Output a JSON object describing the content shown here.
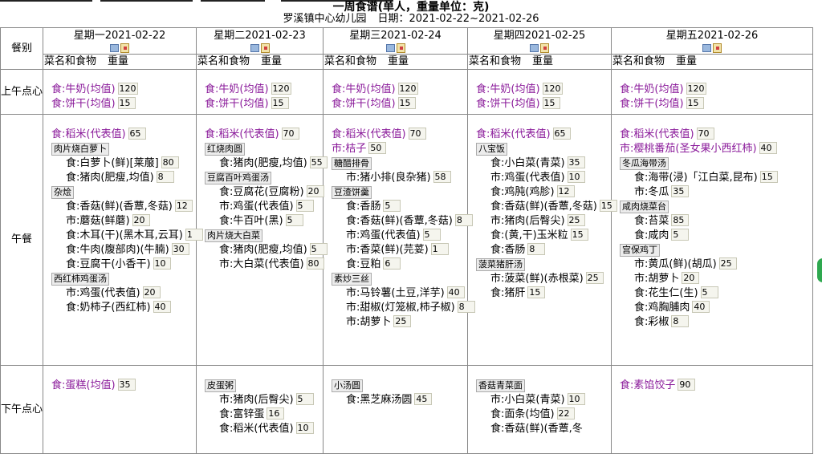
{
  "title": "一周食谱(单人，重量单位：克)",
  "school": "罗溪镇中心幼儿园",
  "date_label": "日期：",
  "date_range": "2021-02-22~2021-02-26",
  "meal_header": "餐别",
  "col_food": "菜名和食物",
  "col_weight": "重量",
  "days": [
    {
      "label": "星期一2021-02-22"
    },
    {
      "label": "星期二2021-02-23"
    },
    {
      "label": "星期三2021-02-24"
    },
    {
      "label": "星期四2021-02-25"
    },
    {
      "label": "星期五2021-02-26"
    }
  ],
  "meals": [
    {
      "label": "上午点心"
    },
    {
      "label": "午餐"
    },
    {
      "label": "下午点心"
    }
  ],
  "morning": [
    [
      {
        "name": "食:牛奶(均值)",
        "q": "120"
      },
      {
        "name": "食:饼干(均值)",
        "q": "15"
      }
    ],
    [
      {
        "name": "食:牛奶(均值)",
        "q": "120"
      },
      {
        "name": "食:饼干(均值)",
        "q": "15"
      }
    ],
    [
      {
        "name": "食:牛奶(均值)",
        "q": "120"
      },
      {
        "name": "食:饼干(均值)",
        "q": "15"
      }
    ],
    [
      {
        "name": "食:牛奶(均值)",
        "q": "120"
      },
      {
        "name": "食:饼干(均值)",
        "q": "15"
      }
    ],
    [
      {
        "name": "食:牛奶(均值)",
        "q": "120"
      },
      {
        "name": "食:饼干(均值)",
        "q": "15"
      }
    ]
  ],
  "lunch": [
    {
      "staple": {
        "name": "食:稻米(代表值)",
        "q": "65"
      },
      "dishes": [
        {
          "dish": "肉片烧白萝卜",
          "items": [
            {
              "n": "食:白萝卜(鲜)[莱菔]",
              "q": "80"
            },
            {
              "n": "食:猪肉(肥瘦,均值)",
              "q": "8"
            }
          ]
        },
        {
          "dish": "杂烩",
          "items": [
            {
              "n": "食:香菇(鲜)(香蕈,冬菇)",
              "q": "12"
            },
            {
              "n": "市:蘑菇(鲜蘑)",
              "q": "20"
            },
            {
              "n": "食:木耳(干)(黑木耳,云耳)",
              "q": "1"
            },
            {
              "n": "食:牛肉(腹部肉)(牛腩)",
              "q": "30"
            },
            {
              "n": "食:豆腐干(小香干)",
              "q": "10"
            }
          ]
        },
        {
          "dish": "西红柿鸡蛋汤",
          "items": [
            {
              "n": "市:鸡蛋(代表值)",
              "q": "20"
            },
            {
              "n": "食:奶柿子(西红柿)",
              "q": "40"
            }
          ]
        }
      ]
    },
    {
      "staple": {
        "name": "食:稻米(代表值)",
        "q": "70"
      },
      "dishes": [
        {
          "dish": "红烧肉圆",
          "items": [
            {
              "n": "食:猪肉(肥瘦,均值)",
              "q": "55"
            }
          ]
        },
        {
          "dish": "豆腐百叶鸡蛋汤",
          "items": [
            {
              "n": "食:豆腐花(豆腐粉)",
              "q": "20"
            },
            {
              "n": "市:鸡蛋(代表值)",
              "q": "5"
            },
            {
              "n": "食:牛百叶(黑)",
              "q": "5"
            }
          ]
        },
        {
          "dish": "肉片烧大白菜",
          "items": [
            {
              "n": "食:猪肉(肥瘦,均值)",
              "q": "5"
            },
            {
              "n": "市:大白菜(代表值)",
              "q": "80"
            }
          ]
        }
      ]
    },
    {
      "staple": {
        "name": "食:稻米(代表值)",
        "q": "70"
      },
      "staple2": {
        "name": "市:桔子",
        "q": "50"
      },
      "dishes": [
        {
          "dish": "糖醋排骨",
          "items": [
            {
              "n": "市:猪小排(良杂猪)",
              "q": "58"
            }
          ]
        },
        {
          "dish": "豆渣饼羹",
          "items": [
            {
              "n": "食:香肠",
              "q": "5"
            },
            {
              "n": "食:香菇(鲜)(香蕈,冬菇)",
              "q": "8"
            },
            {
              "n": "市:鸡蛋(代表值)",
              "q": "5"
            },
            {
              "n": "市:香菜(鲜)(芫荽)",
              "q": "1"
            },
            {
              "n": "食:豆粕",
              "q": "6"
            }
          ]
        },
        {
          "dish": "素炒三丝",
          "items": [
            {
              "n": "市:马铃薯(土豆,洋芋)",
              "q": "40"
            },
            {
              "n": "市:甜椒(灯笼椒,柿子椒)",
              "q": "8"
            },
            {
              "n": "市:胡萝卜",
              "q": "25"
            }
          ]
        }
      ]
    },
    {
      "staple": {
        "name": "食:稻米(代表值)",
        "q": "65"
      },
      "dishes": [
        {
          "dish": "八宝饭",
          "items": [
            {
              "n": "食:小白菜(青菜)",
              "q": "35"
            },
            {
              "n": "市:鸡蛋(代表值)",
              "q": "10"
            },
            {
              "n": "食:鸡肫(鸡胗)",
              "q": "12"
            },
            {
              "n": "食:香菇(鲜)(香蕈,冬菇)",
              "q": "15"
            },
            {
              "n": "市:猪肉(后臀尖)",
              "q": "25"
            },
            {
              "n": "食:(黄,干)玉米粒",
              "q": "15"
            },
            {
              "n": "食:香肠",
              "q": "8"
            }
          ]
        },
        {
          "dish": "菠菜猪肝汤",
          "items": [
            {
              "n": "市:菠菜(鲜)(赤根菜)",
              "q": "25"
            },
            {
              "n": "食:猪肝",
              "q": "15"
            }
          ]
        }
      ]
    },
    {
      "staple": {
        "name": "食:稻米(代表值)",
        "q": "70"
      },
      "staple2": {
        "name": "市:樱桃番茄(圣女果小西红柿)",
        "q": "40"
      },
      "dishes": [
        {
          "dish": "冬瓜海带汤",
          "items": [
            {
              "n": "食:海带(浸)「江白菜,昆布)",
              "q": "15"
            },
            {
              "n": "市:冬瓜",
              "q": "35"
            }
          ]
        },
        {
          "dish": "咸肉烧菜台",
          "items": [
            {
              "n": "食:苔菜",
              "q": "85"
            },
            {
              "n": "食:咸肉",
              "q": "5"
            }
          ]
        },
        {
          "dish": "宫保鸡丁",
          "items": [
            {
              "n": "市:黄瓜(鲜)(胡瓜)",
              "q": "25"
            },
            {
              "n": "市:胡萝卜",
              "q": "20"
            },
            {
              "n": "食:花生仁(生)",
              "q": "5"
            },
            {
              "n": "食:鸡胸脯肉",
              "q": "40"
            },
            {
              "n": "食:彩椒",
              "q": "8"
            }
          ]
        }
      ]
    }
  ],
  "afternoon": [
    {
      "staple": {
        "name": "食:蛋糕(均值)",
        "q": "35"
      }
    },
    {
      "dish": "皮蛋粥",
      "items": [
        {
          "n": "市:猪肉(后臀尖)",
          "q": "5"
        },
        {
          "n": "食:富锌蛋",
          "q": "16"
        },
        {
          "n": "食:稻米(代表值)",
          "q": "10"
        }
      ]
    },
    {
      "dish": "小汤圆",
      "items": [
        {
          "n": "食:黑芝麻汤圆",
          "q": "45"
        }
      ]
    },
    {
      "dish": "香菇青菜面",
      "items": [
        {
          "n": "市:小白菜(青菜)",
          "q": "10"
        },
        {
          "n": "食:面条(均值)",
          "q": "22"
        },
        {
          "n": "食:香菇(鲜)(香蕈,冬"
        }
      ]
    },
    {
      "staple": {
        "name": "食:素馅饺子",
        "q": "90"
      }
    }
  ],
  "icons": [
    "copy-icon",
    "note-icon"
  ],
  "colors": {
    "staple_purple": "#8a1a9a",
    "border": "#888888",
    "qty_bg": "#f5f5ee"
  }
}
